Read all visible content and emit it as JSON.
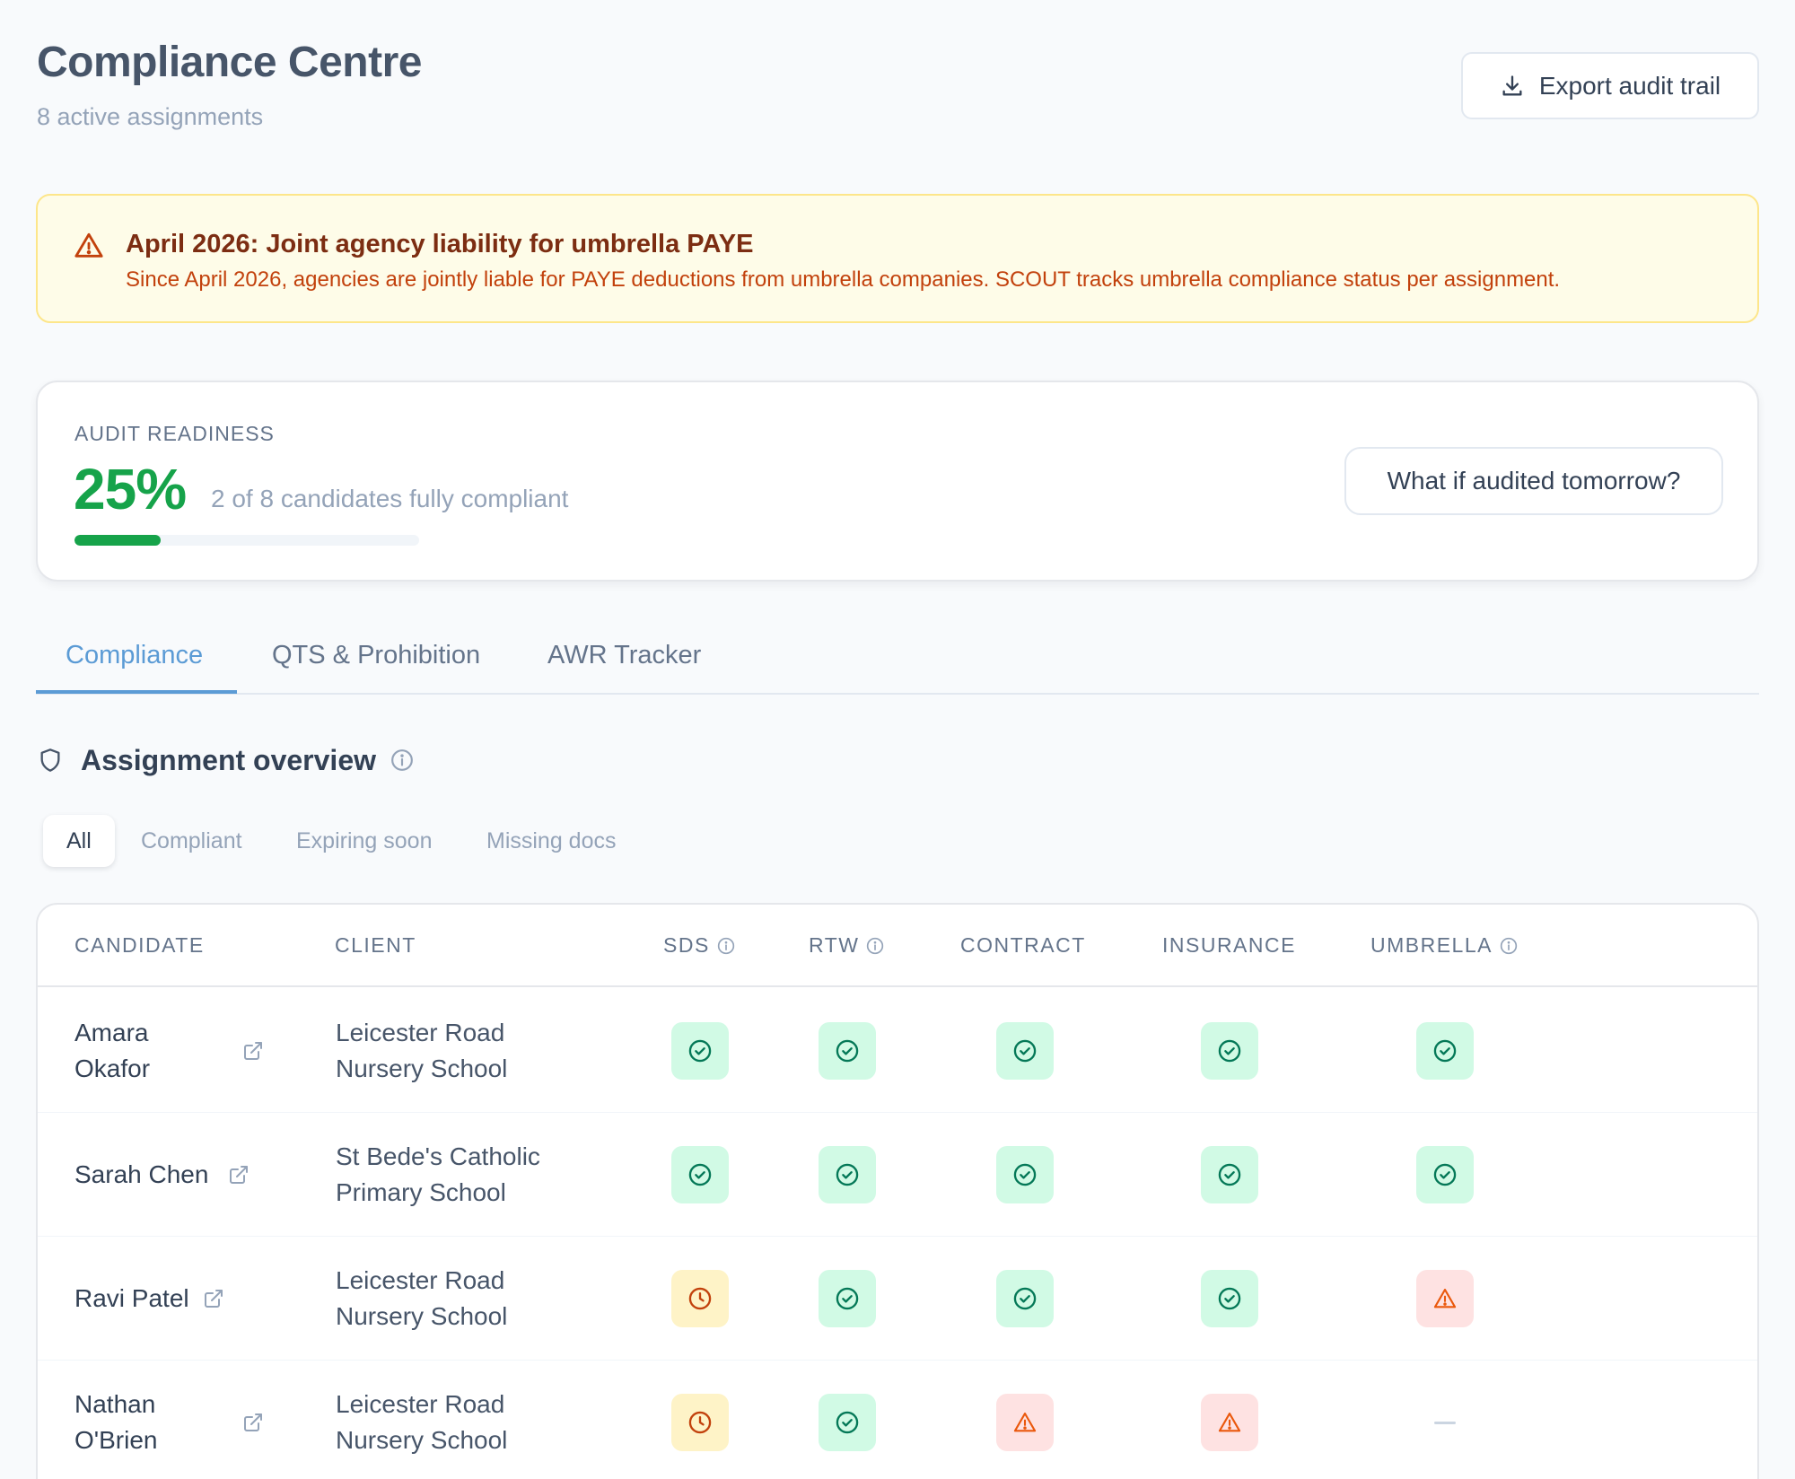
{
  "header": {
    "title": "Compliance Centre",
    "subtitle": "8 active assignments",
    "export_label": "Export audit trail"
  },
  "alert": {
    "title": "April 2026: Joint agency liability for umbrella PAYE",
    "text": "Since April 2026, agencies are jointly liable for PAYE deductions from umbrella companies. SCOUT tracks umbrella compliance status per assignment."
  },
  "readiness": {
    "label": "AUDIT READINESS",
    "percent_text": "25%",
    "percent_value": 25,
    "description": "2 of 8 candidates fully compliant",
    "what_if_label": "What if audited tomorrow?"
  },
  "tabs": [
    {
      "label": "Compliance"
    },
    {
      "label": "QTS & Prohibition"
    },
    {
      "label": "AWR Tracker"
    }
  ],
  "section": {
    "title": "Assignment overview"
  },
  "filters": [
    {
      "label": "All"
    },
    {
      "label": "Compliant"
    },
    {
      "label": "Expiring soon"
    },
    {
      "label": "Missing docs"
    }
  ],
  "table": {
    "columns": [
      "CANDIDATE",
      "CLIENT",
      "SDS",
      "RTW",
      "CONTRACT",
      "INSURANCE",
      "UMBRELLA"
    ],
    "rows": [
      {
        "candidate": "Amara Okafor",
        "client": "Leicester Road Nursery School",
        "sds": "compliant",
        "rtw": "compliant",
        "contract": "compliant",
        "insurance": "compliant",
        "umbrella": "compliant"
      },
      {
        "candidate": "Sarah Chen",
        "client": "St Bede's Catholic Primary School",
        "sds": "compliant",
        "rtw": "compliant",
        "contract": "compliant",
        "insurance": "compliant",
        "umbrella": "compliant"
      },
      {
        "candidate": "Ravi Patel",
        "client": "Leicester Road Nursery School",
        "sds": "expiring",
        "rtw": "compliant",
        "contract": "compliant",
        "insurance": "compliant",
        "umbrella": "warning"
      },
      {
        "candidate": "Nathan O'Brien",
        "client": "Leicester Road Nursery School",
        "sds": "expiring",
        "rtw": "compliant",
        "contract": "warning",
        "insurance": "warning",
        "umbrella": "not-applicable"
      }
    ]
  },
  "colors": {
    "accent": "#5b9bd5",
    "success": "#16a34a",
    "alert_bg": "#fefce8",
    "alert_text": "#c2410c"
  }
}
